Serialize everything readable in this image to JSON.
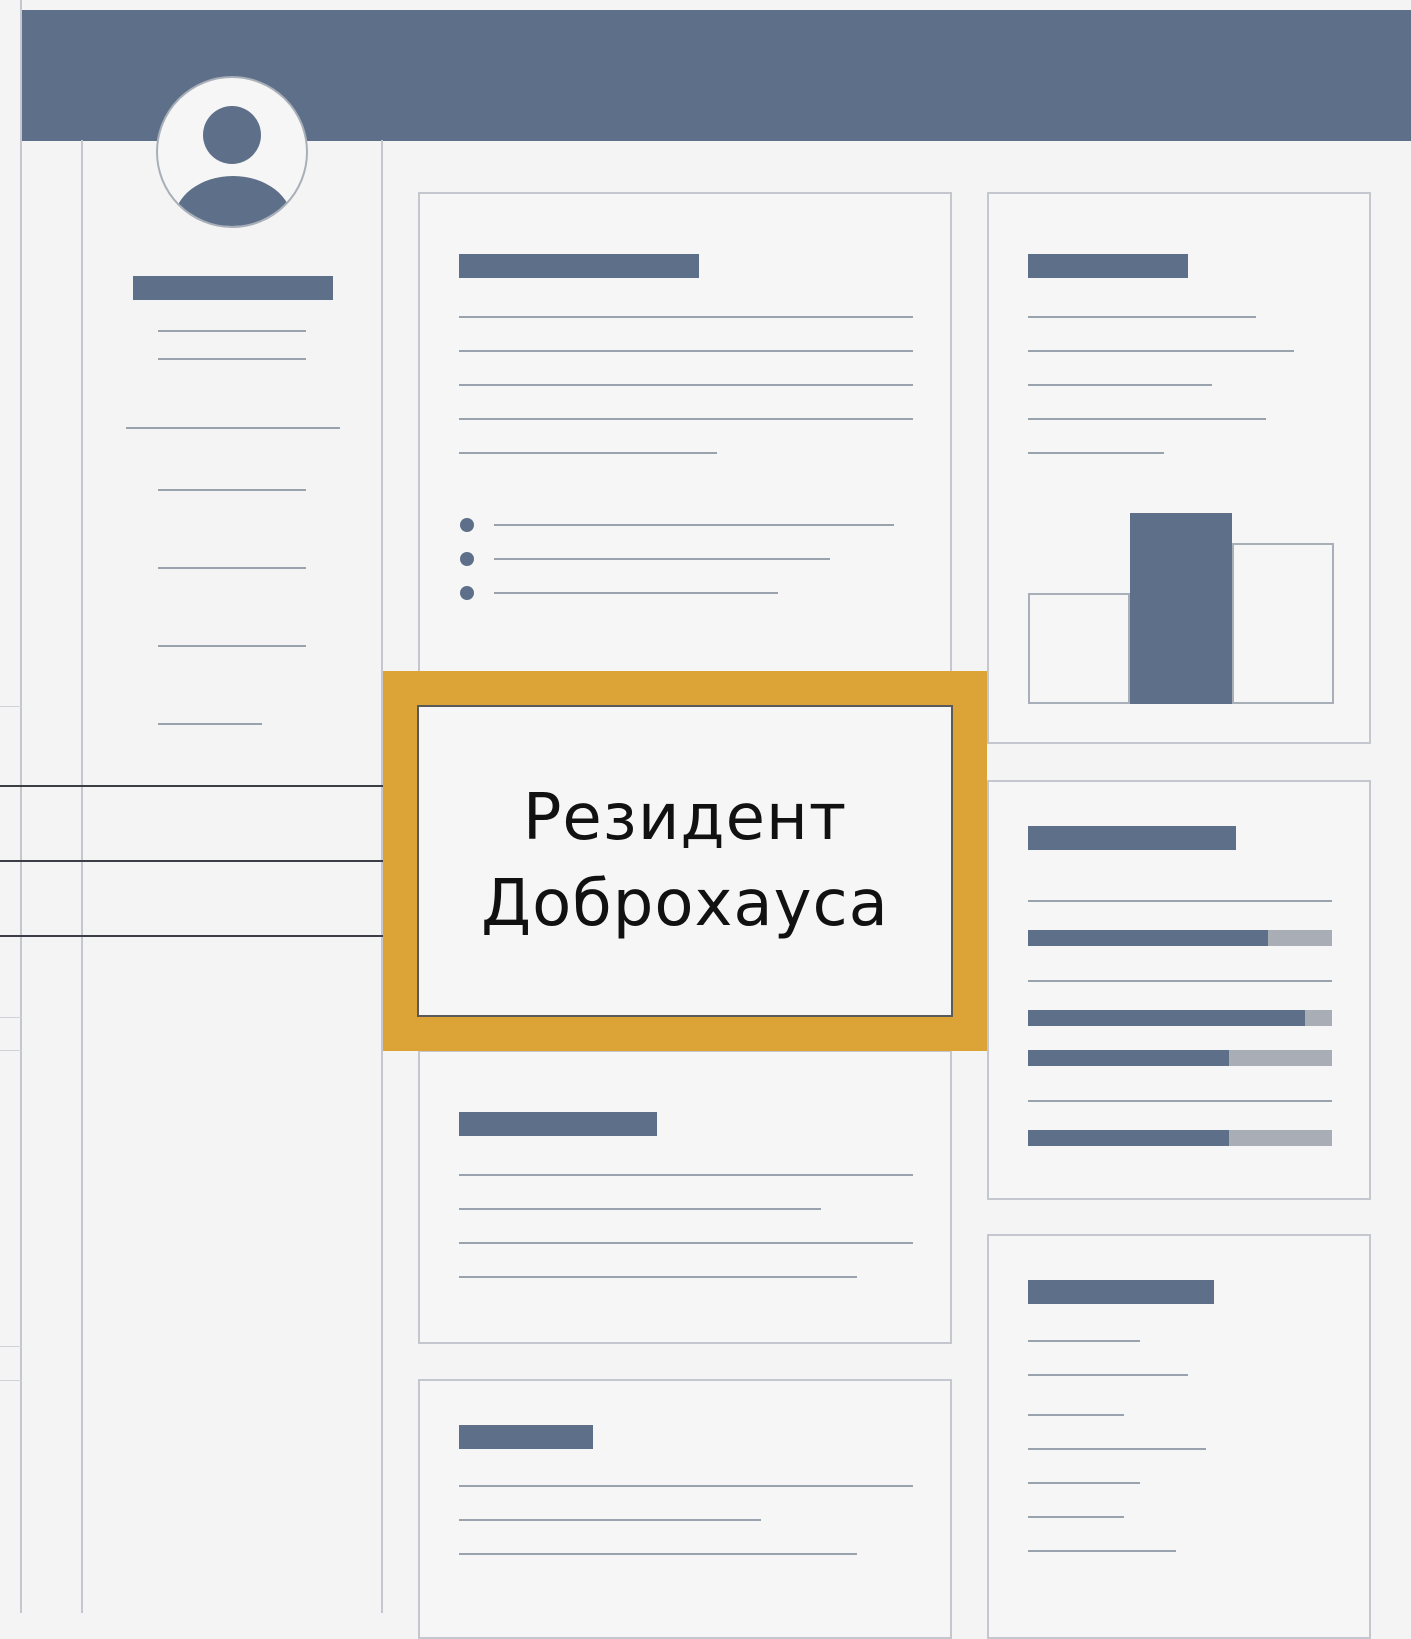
{
  "colors": {
    "header": "#5e7089",
    "accent_bar": "#5e7089",
    "highlight_border": "#dca437",
    "progress_track": "#a9aeb6"
  },
  "icons": {
    "profile": "user-avatar-icon"
  },
  "highlight": {
    "line1": "Резидент",
    "line2": "Доброхауса"
  },
  "chart_data": {
    "type": "bar",
    "categories": [
      "",
      "",
      ""
    ],
    "values": [
      1.1,
      1.9,
      1.6
    ],
    "ylim": [
      0,
      2
    ],
    "grid": false
  },
  "progress_card": {
    "values": [
      0.79,
      0.91,
      0.66,
      0.66
    ]
  }
}
